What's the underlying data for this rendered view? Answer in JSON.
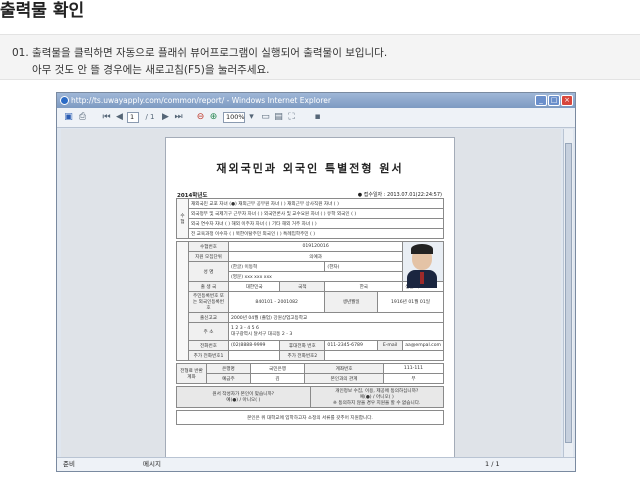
{
  "page": {
    "title": "출력물 확인"
  },
  "instruction": {
    "line1": "01. 출력물을 클릭하면 자동으로 플래쉬 뷰어프로그램이 실행되어 출력물이  보입니다.",
    "line2": "아무 것도 안 뜰 경우에는 새로고침(F5)을 눌러주세요."
  },
  "browser": {
    "title": "http://ts.uwayapply.com/common/report/ - Windows Internet Explorer",
    "controls": {
      "minimize": "_",
      "maximize": "□",
      "close": "×"
    }
  },
  "toolbar": {
    "page_current": "1",
    "page_total": "/ 1",
    "zoom": "100%"
  },
  "status": {
    "left": "준비",
    "middle": "메시지",
    "page": "1 / 1"
  },
  "document": {
    "title": "재외국민과 외국인 특별전형 원서",
    "year": "2014학년도",
    "receipt": "● 접수일자 : 2013.07.01(22:24:57)",
    "section_a": "수험",
    "check_rows": [
      "재외국민 교포 자녀 (●)   재외근무 공무원 자녀 (  )   재외근무 상사직원 자녀 (  )",
      "외국정부 및 국제기구 근무자 자녀 (  )   외국언론사 및 교수요원 자녀 (  )   유학 외국인 (  )",
      "외국 연수자 자녀 (  )   해외 이주자 자녀 (  )   기타 해외 거주 자녀 (  )",
      "전 교육과정 이수자 (  )   북한이탈주민 외국인 (  )   특례입학주민 (  )"
    ],
    "applicant": {
      "exam_no_label": "수험번호",
      "exam_no": "019120016",
      "dept_label": "지원 모집단위",
      "dept": "의예과",
      "name_label": "성    명",
      "name_ko_label": "(한글)",
      "name_ko": "이동혁",
      "name_hanja_label": "(한자)",
      "name_en_label": "(영문)",
      "name_en": "xxx xxx xxx",
      "birth_label": "출 생 국",
      "birth": "대한민국",
      "nat_label": "국적",
      "nat": "한국",
      "gender_label": "성별",
      "gender": "여",
      "id_label": "주민등록번호 또는 외국인등록번호",
      "id": "840101 - 2001082",
      "dob_label": "생년월일",
      "dob": "1916년 01월 01일",
      "school_label": "출신고교",
      "school": "2000년 04월 (졸업)  강원상업고등학교",
      "addr_label": "주    소",
      "zip": "1 2 3 - 4 5 6",
      "addr": "대구광역시 달서구 대곡동 2 - 3",
      "phone_label": "전화번호",
      "phone": "(02)8888-9999",
      "mobile_label": "휴대전화 번호",
      "mobile": "011-2345-6789",
      "email_label": "E-mail",
      "email": "aa@empal.com",
      "extra1_label": "추가 전화번호1",
      "extra2_label": "추가 전화번호2"
    },
    "refund": {
      "label": "전형료 반환계좌",
      "bank_label": "은행명",
      "bank": "국민은행",
      "acct_label": "계좌번호",
      "acct": "111-111",
      "holder_label": "예금주",
      "holder": "김",
      "rel_label": "본인과의 관계",
      "rel": "부"
    },
    "consent": {
      "q1": "원서 작성자가 본인이 맞습니까?",
      "a1": "예(●) / 아니오(  )",
      "q2": "개인정보 수집, 이용, 제공에 동의하십니까?",
      "a2": "예(●) / 아니오(  )",
      "note": "※ 동의하지 않을 경우 지원을 할 수 없습니다."
    },
    "footer": "본인은 위 대학교에 입학하고자 소정의 서류를 갖추어 지원합니다."
  }
}
